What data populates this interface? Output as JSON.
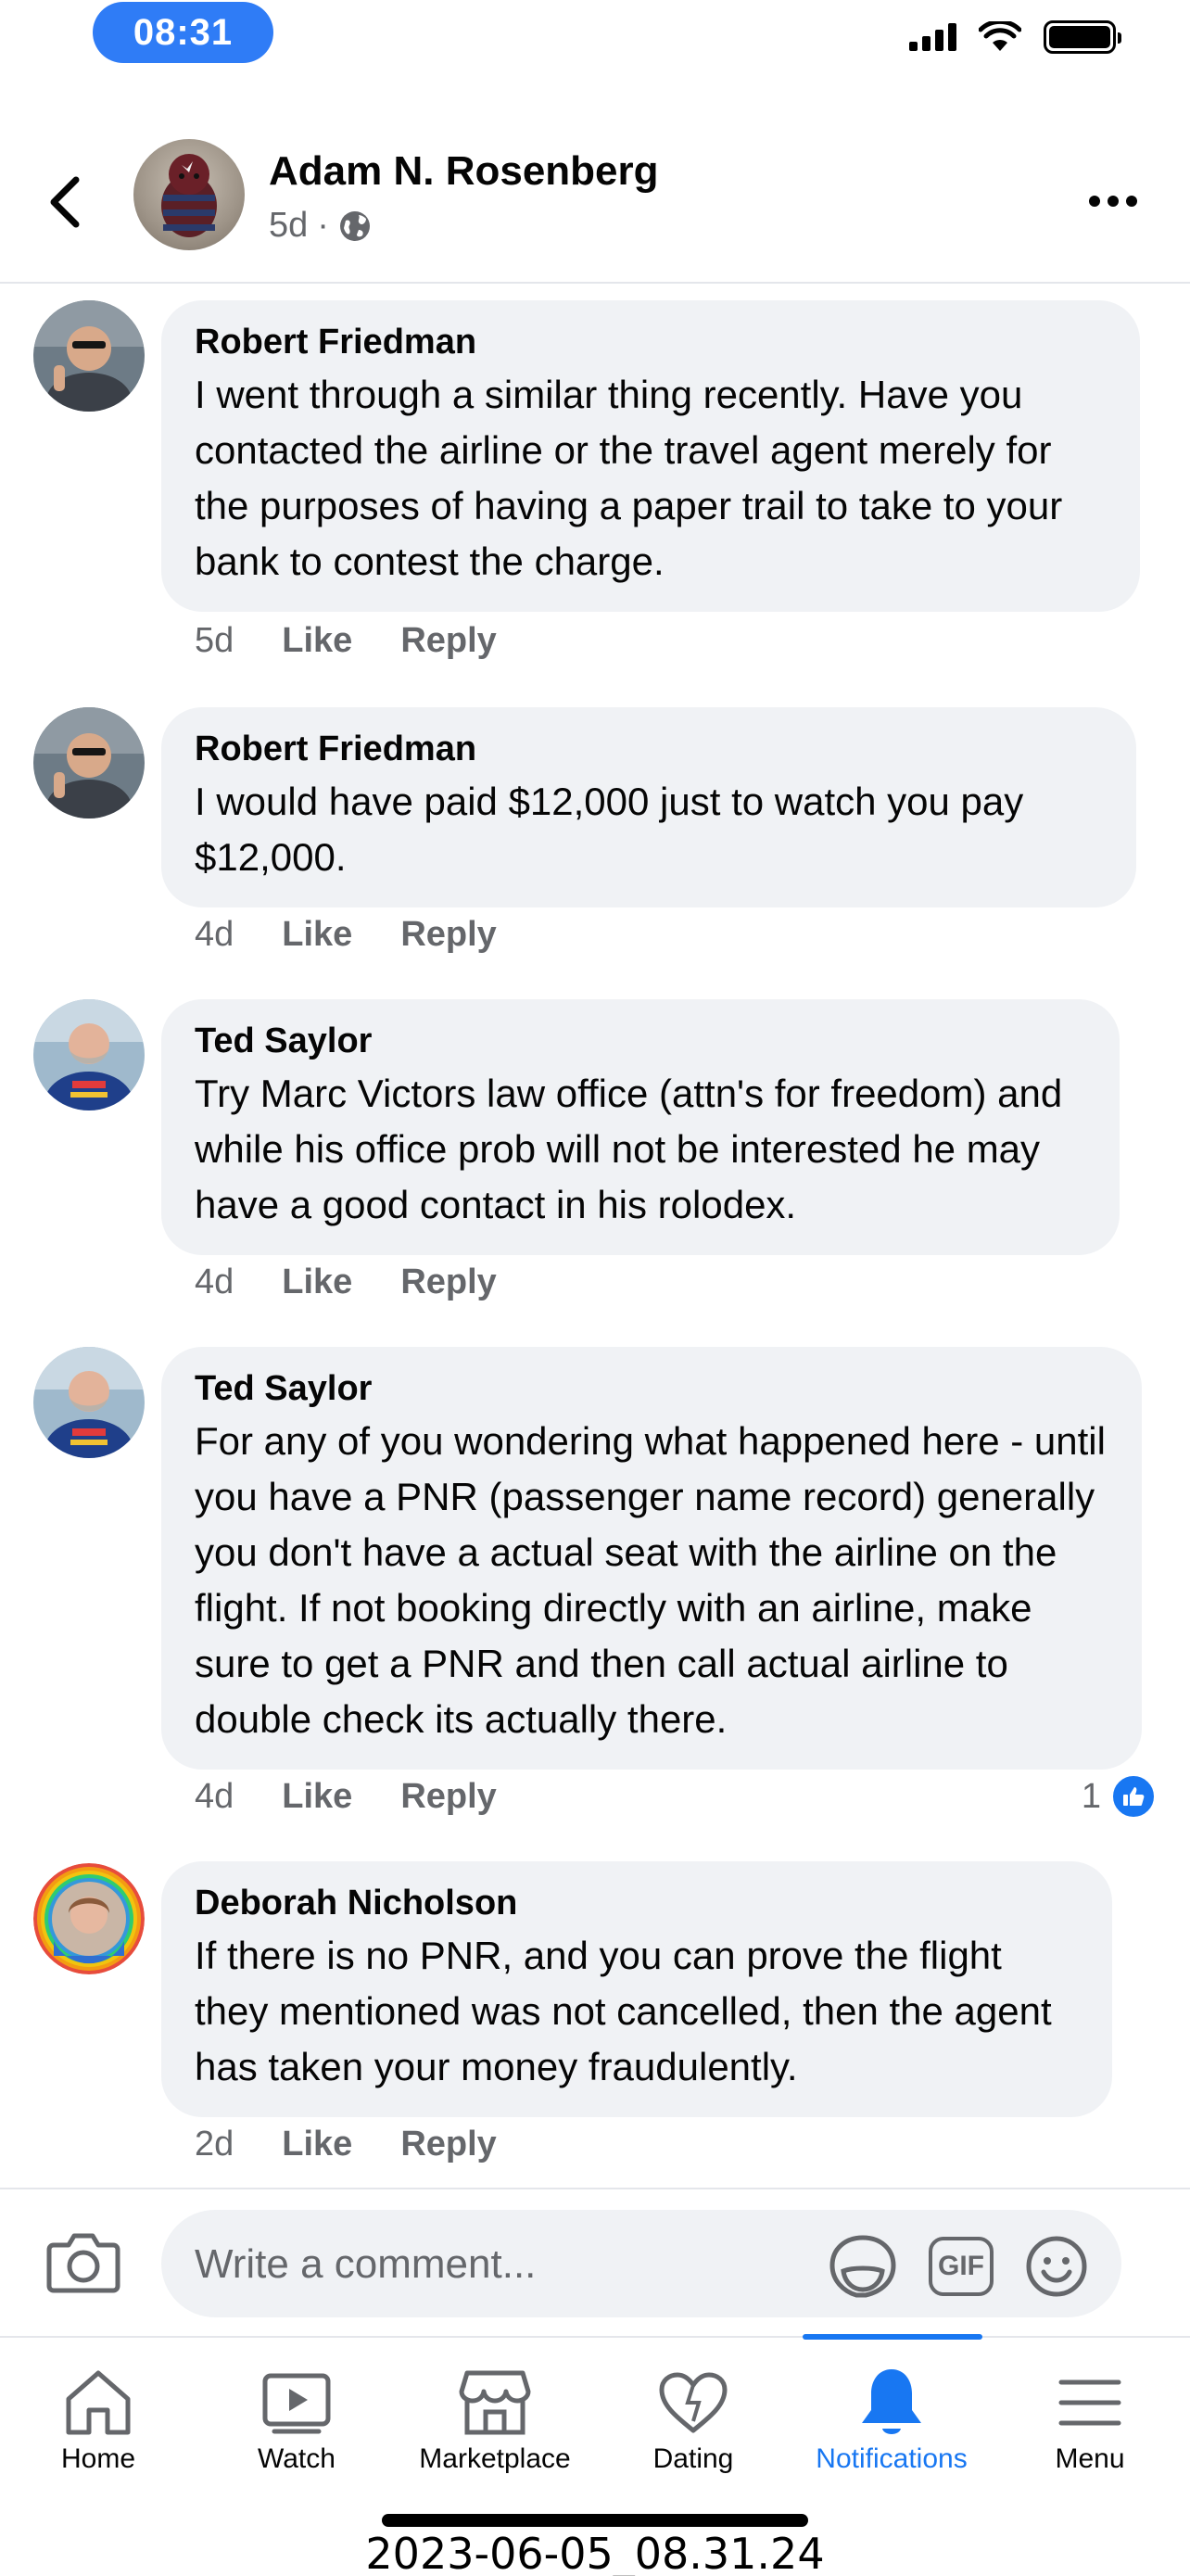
{
  "status_bar": {
    "time": "08:31"
  },
  "header": {
    "name": "Adam N. Rosenberg",
    "age": "5d",
    "separator": "·"
  },
  "comments": [
    {
      "author": "Robert Friedman",
      "text": "I went through a similar thing recently. Have you contacted the airline or the travel agent merely for the purposes of having a paper trail to take to your bank to contest the charge.",
      "age": "5d",
      "like": "Like",
      "reply": "Reply"
    },
    {
      "author": "Robert Friedman",
      "text": "I would have paid $12,000 just to watch you pay $12,000.",
      "age": "4d",
      "like": "Like",
      "reply": "Reply"
    },
    {
      "author": "Ted Saylor",
      "text": "Try Marc Victors law office (attn's for freedom) and while his office prob will not be interested he may have a good contact in his rolodex.",
      "age": "4d",
      "like": "Like",
      "reply": "Reply"
    },
    {
      "author": "Ted Saylor",
      "text": "For any of you wondering what happened here - until you have a PNR (passenger name record) generally you don't have a actual seat with the airline on the flight. If not booking directly with an airline, make sure to get a PNR and then call actual airline to double check its actually there.",
      "age": "4d",
      "like": "Like",
      "reply": "Reply",
      "reaction_count": "1"
    },
    {
      "author": "Deborah Nicholson",
      "text": "If there is no PNR, and you can prove the flight they mentioned was not cancelled, then the agent has taken your money fraudulently.",
      "age": "2d",
      "like": "Like",
      "reply": "Reply"
    }
  ],
  "composer": {
    "placeholder": "Write a comment...",
    "gif_label": "GIF"
  },
  "tabs": [
    {
      "label": "Home",
      "icon": "home-icon"
    },
    {
      "label": "Watch",
      "icon": "watch-icon"
    },
    {
      "label": "Marketplace",
      "icon": "marketplace-icon"
    },
    {
      "label": "Dating",
      "icon": "dating-icon"
    },
    {
      "label": "Notifications",
      "icon": "bell-icon",
      "active": true
    },
    {
      "label": "Menu",
      "icon": "menu-icon"
    }
  ],
  "caption": "2023-06-05_08.31.24",
  "colors": {
    "accent": "#1877f2",
    "bubble": "#f0f2f5",
    "secondary_text": "#65676b"
  }
}
